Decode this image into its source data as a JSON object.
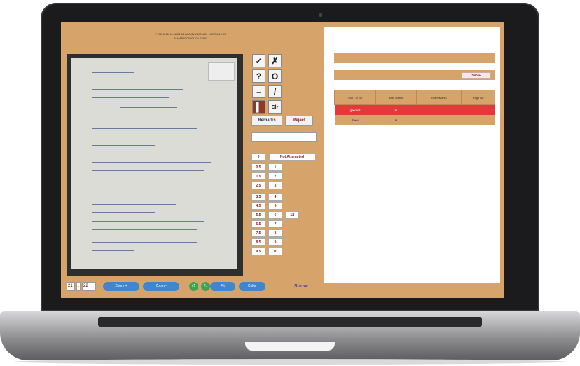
{
  "header": {
    "line1": "P106  3666   10.06.21   11   AAA-3VV8A01601 10/6/34-19:00",
    "line2": "Sub:AFF0C0801/C0  03503"
  },
  "tools": {
    "check": "✓",
    "cross": "✗",
    "question": "?",
    "circle": "O",
    "dash": "–",
    "slash": "/",
    "pen": "▌",
    "clear": "Clr",
    "remarks": "Remarks",
    "reject": "Reject"
  },
  "marks": {
    "not_attempted_value": "0",
    "not_attempted_label": "Not Attempted",
    "half": [
      "0.5",
      "1.5",
      "2.5",
      "3.5",
      "4.5",
      "5.5",
      "6.5",
      "7.5",
      "8.5",
      "9.5"
    ],
    "whole": [
      "1",
      "2",
      "3",
      "4",
      "5",
      "6",
      "7",
      "8",
      "9",
      "10"
    ],
    "extra": "11"
  },
  "right": {
    "save_label": "SAVE",
    "columns": [
      "Sub - Q No",
      "Max Marks",
      "Exam Marks",
      "Page No"
    ],
    "rows": [
      {
        "sub": "Q.NO.01",
        "max": "11",
        "marks": "",
        "page": "",
        "highlight": true
      },
      {
        "sub": "Total",
        "max": "11",
        "marks": "",
        "page": "",
        "highlight": false
      }
    ]
  },
  "bottom": {
    "page_current": "21",
    "page_total": "22",
    "zoom_in": "Zoom +",
    "zoom_out": "Zoom -",
    "fit": "Fit",
    "color": "Color",
    "show": "Show"
  }
}
